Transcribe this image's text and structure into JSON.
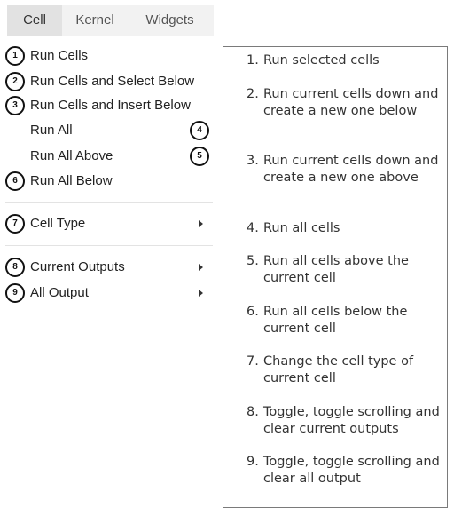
{
  "menubar": {
    "tabs": [
      {
        "label": "Cell",
        "active": true
      },
      {
        "label": "Kernel",
        "active": false
      },
      {
        "label": "Widgets",
        "active": false
      }
    ]
  },
  "menu": {
    "items": [
      {
        "label": "Run Cells",
        "badge": "1",
        "badge_side": "left"
      },
      {
        "label": "Run Cells and Select Below",
        "badge": "2",
        "badge_side": "left"
      },
      {
        "label": "Run Cells and Insert Below",
        "badge": "3",
        "badge_side": "left"
      },
      {
        "label": "Run All",
        "badge": "4",
        "badge_side": "right"
      },
      {
        "label": "Run All Above",
        "badge": "5",
        "badge_side": "right"
      },
      {
        "label": "Run All Below",
        "badge": "6",
        "badge_side": "left"
      },
      {
        "label": "Cell Type",
        "badge": "7",
        "badge_side": "left",
        "submenu": true
      },
      {
        "label": "Current Outputs",
        "badge": "8",
        "badge_side": "left",
        "submenu": true
      },
      {
        "label": "All Output",
        "badge": "9",
        "badge_side": "left",
        "submenu": true
      }
    ]
  },
  "legend": {
    "items": [
      {
        "number": "1.",
        "text": "Run selected cells"
      },
      {
        "number": "2.",
        "text": "Run current cells down and create a new one below"
      },
      {
        "number": "3.",
        "text": "Run current cells down and create a new one above"
      },
      {
        "number": "4.",
        "text": "Run all cells"
      },
      {
        "number": "5.",
        "text": "Run all cells above the current cell"
      },
      {
        "number": "6.",
        "text": "Run all cells below the current cell"
      },
      {
        "number": "7.",
        "text": "Change the cell type of current cell"
      },
      {
        "number": "8.",
        "text": "Toggle, toggle scrolling and clear current outputs"
      },
      {
        "number": "9.",
        "text": "Toggle, toggle scrolling and clear all output"
      }
    ]
  }
}
